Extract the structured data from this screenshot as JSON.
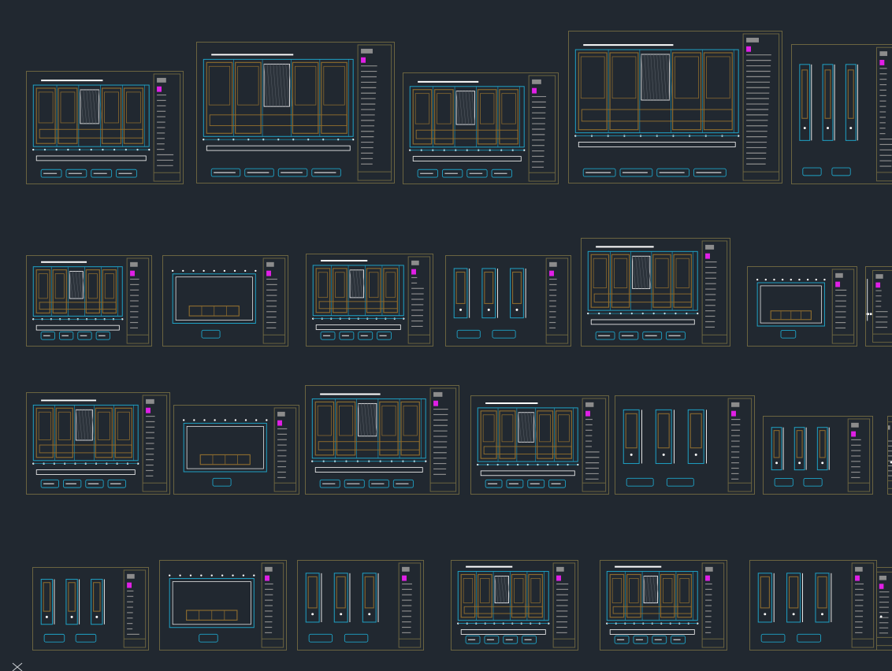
{
  "app": {
    "view": "model-space",
    "background_color": "#212830"
  },
  "colors": {
    "frame": "#6b6440",
    "cyan": "#1fa3c7",
    "white": "#ffffff",
    "magenta": "#e01fe6",
    "brown": "#8a6a2f",
    "dim": "#8c8c8c"
  },
  "sheets": [
    {
      "row": 1,
      "kind": "elevation"
    },
    {
      "row": 1,
      "kind": "elevation"
    },
    {
      "row": 1,
      "kind": "elevation"
    },
    {
      "row": 1,
      "kind": "elevation"
    },
    {
      "row": 1,
      "kind": "detail"
    },
    {
      "row": 2,
      "kind": "elevation"
    },
    {
      "row": 2,
      "kind": "plan"
    },
    {
      "row": 2,
      "kind": "elevation"
    },
    {
      "row": 2,
      "kind": "detail"
    },
    {
      "row": 2,
      "kind": "elevation"
    },
    {
      "row": 2,
      "kind": "plan"
    },
    {
      "row": 2,
      "kind": "detail"
    },
    {
      "row": 3,
      "kind": "elevation"
    },
    {
      "row": 3,
      "kind": "plan"
    },
    {
      "row": 3,
      "kind": "elevation"
    },
    {
      "row": 3,
      "kind": "elevation"
    },
    {
      "row": 3,
      "kind": "detail"
    },
    {
      "row": 3,
      "kind": "detail"
    },
    {
      "row": 3,
      "kind": "detail"
    },
    {
      "row": 4,
      "kind": "detail"
    },
    {
      "row": 4,
      "kind": "plan"
    },
    {
      "row": 4,
      "kind": "detail"
    },
    {
      "row": 4,
      "kind": "elevation"
    },
    {
      "row": 4,
      "kind": "elevation"
    },
    {
      "row": 4,
      "kind": "detail"
    },
    {
      "row": 4,
      "kind": "detail"
    }
  ],
  "ucs_icon": "ucs-axis-icon"
}
